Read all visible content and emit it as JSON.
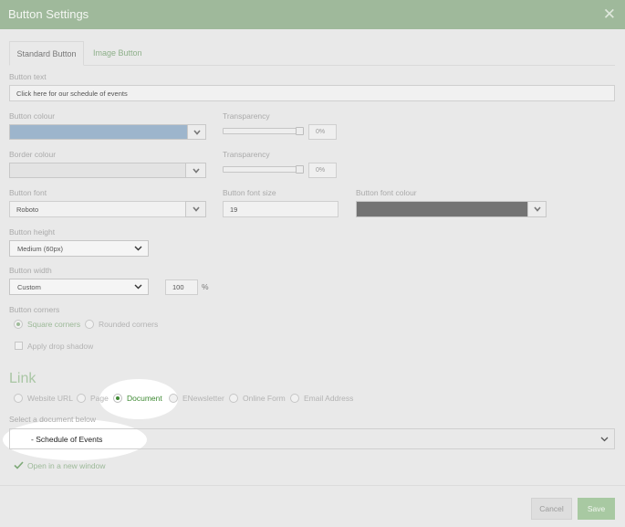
{
  "dialog": {
    "title": "Button Settings"
  },
  "tabs": [
    {
      "label": "Standard Button",
      "active": true
    },
    {
      "label": "Image Button",
      "active": false
    }
  ],
  "button_text": {
    "label": "Button text",
    "value": "Click here for our schedule of events"
  },
  "button_colour": {
    "label": "Button colour",
    "color": "#9db5cc"
  },
  "button_transparency": {
    "label": "Transparency",
    "value": "0%",
    "level": 0
  },
  "border_colour": {
    "label": "Border colour",
    "color": "#e3e3e3"
  },
  "border_transparency": {
    "label": "Transparency",
    "value": "0%",
    "level": 0
  },
  "button_font": {
    "label": "Button font",
    "value": "Roboto"
  },
  "button_font_size": {
    "label": "Button font size",
    "value": "19"
  },
  "button_font_colour": {
    "label": "Button font colour",
    "color": "#737373"
  },
  "button_height": {
    "label": "Button height",
    "value": "Medium (60px)"
  },
  "button_width": {
    "label": "Button width",
    "value": "Custom",
    "custom_value": "100",
    "unit": "%"
  },
  "button_corners": {
    "label": "Button corners",
    "options": [
      {
        "label": "Square corners",
        "selected": true
      },
      {
        "label": "Rounded corners",
        "selected": false
      }
    ]
  },
  "drop_shadow": {
    "label": "Apply drop shadow",
    "checked": false
  },
  "link": {
    "heading": "Link",
    "options": [
      {
        "label": "Website URL",
        "selected": false
      },
      {
        "label": "Page",
        "selected": false
      },
      {
        "label": "Document",
        "selected": true
      },
      {
        "label": "ENewsletter",
        "selected": false
      },
      {
        "label": "Online Form",
        "selected": false
      },
      {
        "label": "Email Address",
        "selected": false
      }
    ],
    "document_label": "Select a document below",
    "document_value": "- Schedule of Events",
    "new_window_label": "Open in a new window",
    "new_window_checked": true
  },
  "footer": {
    "cancel": "Cancel",
    "save": "Save"
  },
  "colors": {
    "accent": "#9fb99b",
    "selected_radio": "#3f8a34"
  }
}
